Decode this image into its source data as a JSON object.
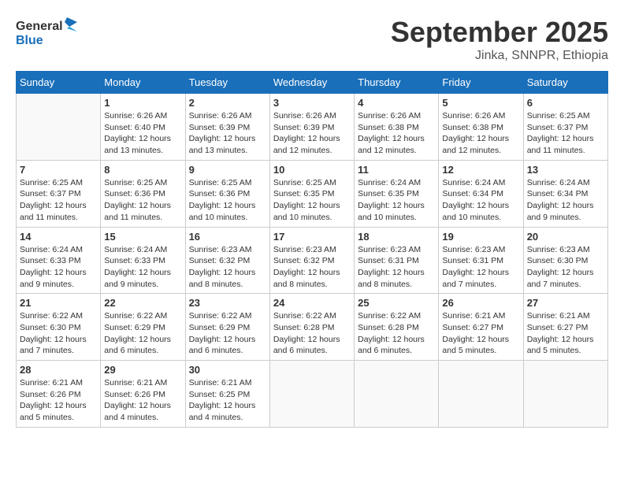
{
  "header": {
    "logo_general": "General",
    "logo_blue": "Blue",
    "month_title": "September 2025",
    "location": "Jinka, SNNPR, Ethiopia"
  },
  "weekdays": [
    "Sunday",
    "Monday",
    "Tuesday",
    "Wednesday",
    "Thursday",
    "Friday",
    "Saturday"
  ],
  "weeks": [
    [
      {
        "day": "",
        "info": ""
      },
      {
        "day": "1",
        "info": "Sunrise: 6:26 AM\nSunset: 6:40 PM\nDaylight: 12 hours\nand 13 minutes."
      },
      {
        "day": "2",
        "info": "Sunrise: 6:26 AM\nSunset: 6:39 PM\nDaylight: 12 hours\nand 13 minutes."
      },
      {
        "day": "3",
        "info": "Sunrise: 6:26 AM\nSunset: 6:39 PM\nDaylight: 12 hours\nand 12 minutes."
      },
      {
        "day": "4",
        "info": "Sunrise: 6:26 AM\nSunset: 6:38 PM\nDaylight: 12 hours\nand 12 minutes."
      },
      {
        "day": "5",
        "info": "Sunrise: 6:26 AM\nSunset: 6:38 PM\nDaylight: 12 hours\nand 12 minutes."
      },
      {
        "day": "6",
        "info": "Sunrise: 6:25 AM\nSunset: 6:37 PM\nDaylight: 12 hours\nand 11 minutes."
      }
    ],
    [
      {
        "day": "7",
        "info": "Sunrise: 6:25 AM\nSunset: 6:37 PM\nDaylight: 12 hours\nand 11 minutes."
      },
      {
        "day": "8",
        "info": "Sunrise: 6:25 AM\nSunset: 6:36 PM\nDaylight: 12 hours\nand 11 minutes."
      },
      {
        "day": "9",
        "info": "Sunrise: 6:25 AM\nSunset: 6:36 PM\nDaylight: 12 hours\nand 10 minutes."
      },
      {
        "day": "10",
        "info": "Sunrise: 6:25 AM\nSunset: 6:35 PM\nDaylight: 12 hours\nand 10 minutes."
      },
      {
        "day": "11",
        "info": "Sunrise: 6:24 AM\nSunset: 6:35 PM\nDaylight: 12 hours\nand 10 minutes."
      },
      {
        "day": "12",
        "info": "Sunrise: 6:24 AM\nSunset: 6:34 PM\nDaylight: 12 hours\nand 10 minutes."
      },
      {
        "day": "13",
        "info": "Sunrise: 6:24 AM\nSunset: 6:34 PM\nDaylight: 12 hours\nand 9 minutes."
      }
    ],
    [
      {
        "day": "14",
        "info": "Sunrise: 6:24 AM\nSunset: 6:33 PM\nDaylight: 12 hours\nand 9 minutes."
      },
      {
        "day": "15",
        "info": "Sunrise: 6:24 AM\nSunset: 6:33 PM\nDaylight: 12 hours\nand 9 minutes."
      },
      {
        "day": "16",
        "info": "Sunrise: 6:23 AM\nSunset: 6:32 PM\nDaylight: 12 hours\nand 8 minutes."
      },
      {
        "day": "17",
        "info": "Sunrise: 6:23 AM\nSunset: 6:32 PM\nDaylight: 12 hours\nand 8 minutes."
      },
      {
        "day": "18",
        "info": "Sunrise: 6:23 AM\nSunset: 6:31 PM\nDaylight: 12 hours\nand 8 minutes."
      },
      {
        "day": "19",
        "info": "Sunrise: 6:23 AM\nSunset: 6:31 PM\nDaylight: 12 hours\nand 7 minutes."
      },
      {
        "day": "20",
        "info": "Sunrise: 6:23 AM\nSunset: 6:30 PM\nDaylight: 12 hours\nand 7 minutes."
      }
    ],
    [
      {
        "day": "21",
        "info": "Sunrise: 6:22 AM\nSunset: 6:30 PM\nDaylight: 12 hours\nand 7 minutes."
      },
      {
        "day": "22",
        "info": "Sunrise: 6:22 AM\nSunset: 6:29 PM\nDaylight: 12 hours\nand 6 minutes."
      },
      {
        "day": "23",
        "info": "Sunrise: 6:22 AM\nSunset: 6:29 PM\nDaylight: 12 hours\nand 6 minutes."
      },
      {
        "day": "24",
        "info": "Sunrise: 6:22 AM\nSunset: 6:28 PM\nDaylight: 12 hours\nand 6 minutes."
      },
      {
        "day": "25",
        "info": "Sunrise: 6:22 AM\nSunset: 6:28 PM\nDaylight: 12 hours\nand 6 minutes."
      },
      {
        "day": "26",
        "info": "Sunrise: 6:21 AM\nSunset: 6:27 PM\nDaylight: 12 hours\nand 5 minutes."
      },
      {
        "day": "27",
        "info": "Sunrise: 6:21 AM\nSunset: 6:27 PM\nDaylight: 12 hours\nand 5 minutes."
      }
    ],
    [
      {
        "day": "28",
        "info": "Sunrise: 6:21 AM\nSunset: 6:26 PM\nDaylight: 12 hours\nand 5 minutes."
      },
      {
        "day": "29",
        "info": "Sunrise: 6:21 AM\nSunset: 6:26 PM\nDaylight: 12 hours\nand 4 minutes."
      },
      {
        "day": "30",
        "info": "Sunrise: 6:21 AM\nSunset: 6:25 PM\nDaylight: 12 hours\nand 4 minutes."
      },
      {
        "day": "",
        "info": ""
      },
      {
        "day": "",
        "info": ""
      },
      {
        "day": "",
        "info": ""
      },
      {
        "day": "",
        "info": ""
      }
    ]
  ]
}
